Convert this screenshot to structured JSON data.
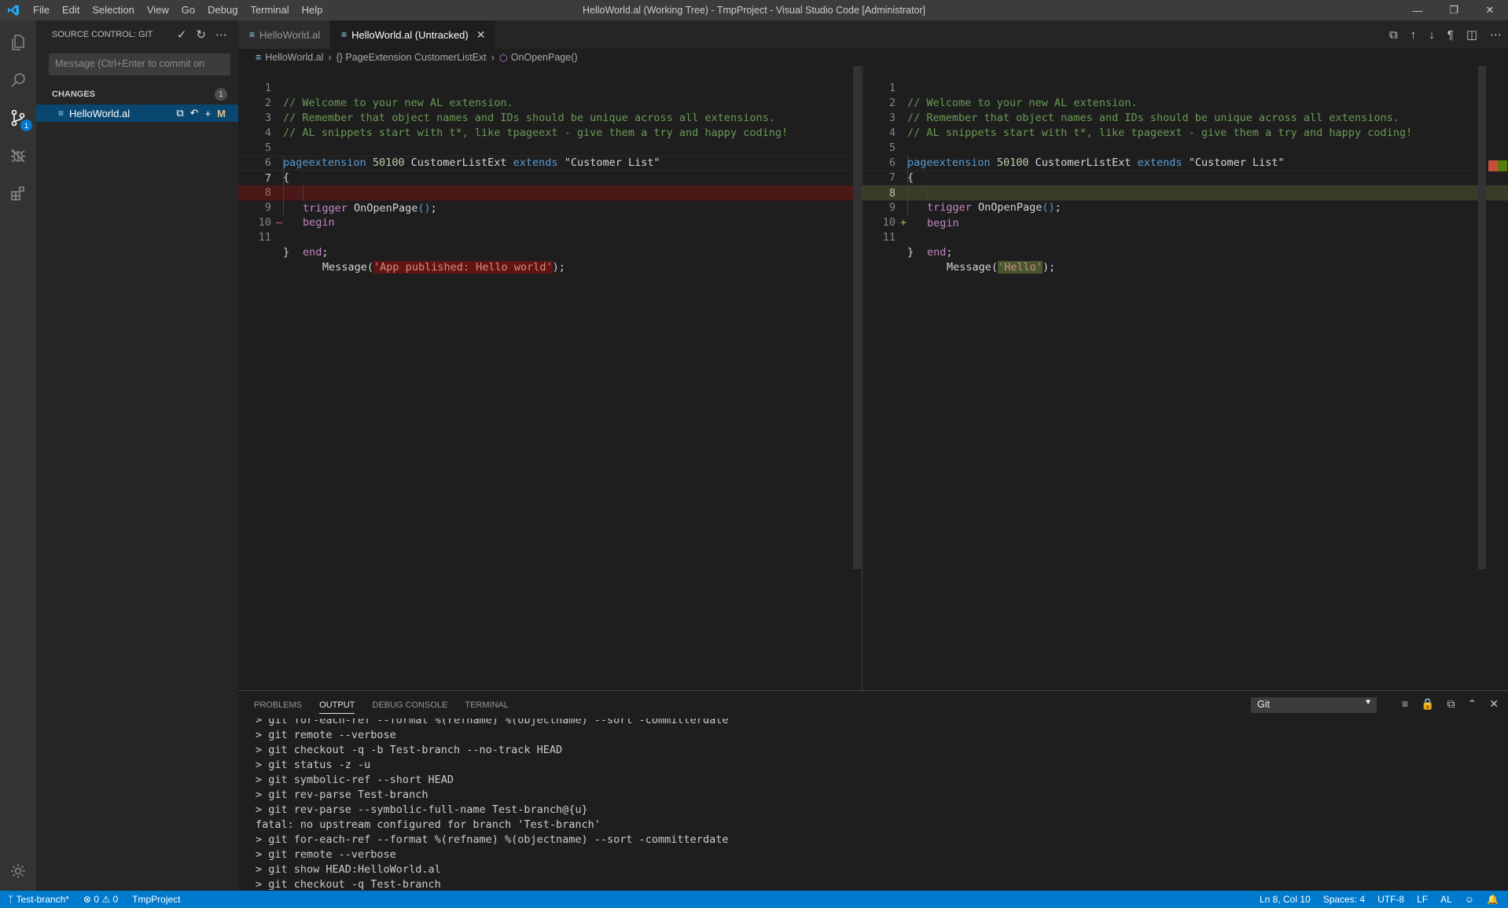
{
  "titlebar": {
    "title": "HelloWorld.al (Working Tree) - TmpProject - Visual Studio Code [Administrator]",
    "menu": [
      "File",
      "Edit",
      "Selection",
      "View",
      "Go",
      "Debug",
      "Terminal",
      "Help"
    ]
  },
  "sidebar": {
    "header": "SOURCE CONTROL: GIT",
    "commit_placeholder": "Message (Ctrl+Enter to commit on",
    "changes_label": "CHANGES",
    "changes_count": "1",
    "file_name": "HelloWorld.al",
    "file_status": "M",
    "scm_badge": "1"
  },
  "tabs": [
    {
      "label": "HelloWorld.al"
    },
    {
      "label": "HelloWorld.al (Untracked)"
    }
  ],
  "breadcrumb": {
    "file": "HelloWorld.al",
    "object": "{} PageExtension CustomerListExt",
    "method": "OnOpenPage()"
  },
  "left_editor": {
    "line_numbers": [
      "1",
      "2",
      "3",
      "4",
      "5",
      "6",
      "7",
      "8",
      "9",
      "10",
      "11"
    ],
    "line1": "// Welcome to your new AL extension.",
    "line2": "// Remember that object names and IDs should be unique across all extensions.",
    "line3": "// AL snippets start with t*, like tpageext - give them a try and happy coding!",
    "line5_kw": "pageextension",
    "line5_num": "50100",
    "line5_name": "CustomerListExt",
    "line5_ext": "extends",
    "line5_str": "\"Customer List\"",
    "line6": "{",
    "line7_kw": "trigger",
    "line7_fn": "OnOpenPage",
    "line7_paren": "()",
    "line7_semi": ";",
    "line8": "begin",
    "line9_fn": "Message",
    "line9_open": "(",
    "line9_str": "'App published: Hello world'",
    "line9_close": ");",
    "line10_kw": "end",
    "line10_semi": ";",
    "line11": "}",
    "gutter_mark": "—"
  },
  "right_editor": {
    "line_numbers": [
      "1",
      "2",
      "3",
      "4",
      "5",
      "6",
      "7",
      "8",
      "9",
      "10",
      "11"
    ],
    "line1": "// Welcome to your new AL extension.",
    "line2": "// Remember that object names and IDs should be unique across all extensions.",
    "line3": "// AL snippets start with t*, like tpageext - give them a try and happy coding!",
    "line5_kw": "pageextension",
    "line5_num": "50100",
    "line5_name": "CustomerListExt",
    "line5_ext": "extends",
    "line5_str": "\"Customer List\"",
    "line6": "{",
    "line7_kw": "trigger",
    "line7_fn": "OnOpenPage",
    "line7_paren": "()",
    "line7_semi": ";",
    "line8": "begin",
    "line9_fn": "Message",
    "line9_open": "(",
    "line9_str": "'Hello'",
    "line9_close": ");",
    "line10_kw": "end",
    "line10_semi": ";",
    "line11": "}",
    "gutter_mark": "+"
  },
  "panel": {
    "tabs": [
      "PROBLEMS",
      "OUTPUT",
      "DEBUG CONSOLE",
      "TERMINAL"
    ],
    "channel": "Git",
    "output": [
      "> git for-each-ref --format %(refname) %(objectname) --sort -committerdate",
      "> git remote --verbose",
      "> git checkout -q -b Test-branch --no-track HEAD",
      "> git status -z -u",
      "> git symbolic-ref --short HEAD",
      "> git rev-parse Test-branch",
      "> git rev-parse --symbolic-full-name Test-branch@{u}",
      "fatal: no upstream configured for branch 'Test-branch'",
      "> git for-each-ref --format %(refname) %(objectname) --sort -committerdate",
      "> git remote --verbose",
      "> git show HEAD:HelloWorld.al",
      "> git checkout -q Test-branch"
    ]
  },
  "statusbar": {
    "branch": "Test-branch*",
    "errors": "0",
    "warnings": "0",
    "project": "TmpProject",
    "position": "Ln 8, Col 10",
    "spaces": "Spaces: 4",
    "encoding": "UTF-8",
    "eol": "LF",
    "language": "AL"
  },
  "colors": {
    "accent": "#007acc",
    "removed": "#4b1818",
    "added": "#373d29"
  }
}
